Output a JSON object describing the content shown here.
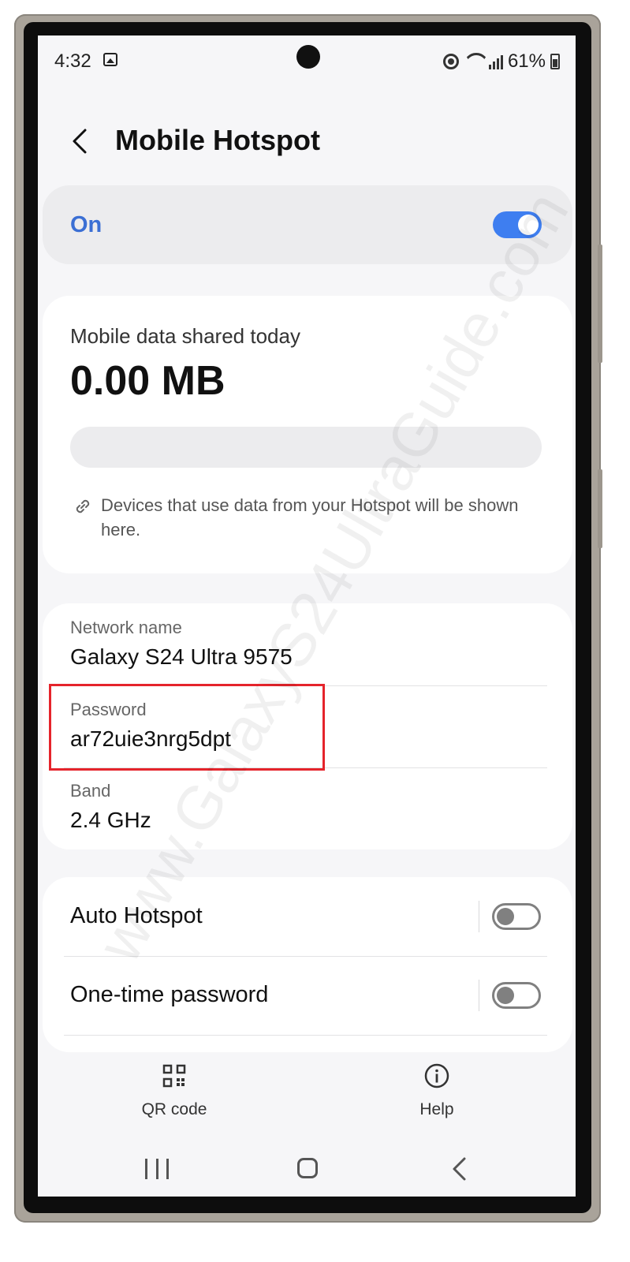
{
  "status_bar": {
    "time": "4:32",
    "battery": "61%"
  },
  "header": {
    "title": "Mobile Hotspot"
  },
  "hotspot": {
    "state_label": "On",
    "enabled": true
  },
  "usage": {
    "label": "Mobile data shared today",
    "value": "0.00 MB",
    "note": "Devices that use data from your Hotspot will be shown here."
  },
  "network": {
    "name_label": "Network name",
    "name_value": "Galaxy S24 Ultra 9575",
    "password_label": "Password",
    "password_value": "ar72uie3nrg5dpt",
    "band_label": "Band",
    "band_value": "2.4 GHz"
  },
  "options": {
    "auto_hotspot_label": "Auto Hotspot",
    "auto_hotspot_enabled": false,
    "one_time_password_label": "One-time password",
    "one_time_password_enabled": false
  },
  "actions": {
    "qr_label": "QR code",
    "help_label": "Help"
  },
  "watermark": "www.GalaxyS24UltraGuide.com",
  "colors": {
    "accent": "#3e7ef0",
    "on_text": "#3b6fd4",
    "highlight": "#e5242b"
  }
}
